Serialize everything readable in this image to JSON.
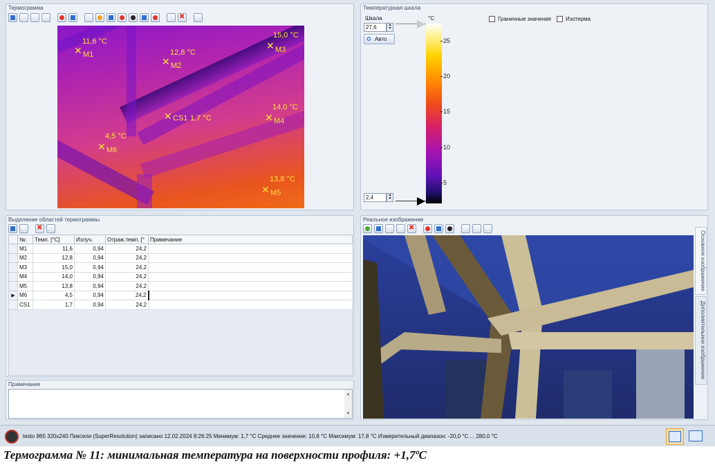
{
  "thermogram_panel": {
    "title": "Термограмма",
    "markers": [
      {
        "id": "M1",
        "temp": "11,6 °C"
      },
      {
        "id": "M2",
        "temp": "12,8 °C"
      },
      {
        "id": "M3",
        "temp": "15,0 °C"
      },
      {
        "id": "M4",
        "temp": "14,0 °C"
      },
      {
        "id": "M5",
        "temp": "13,8 °C"
      },
      {
        "id": "M6",
        "temp": "4,5 °C"
      },
      {
        "id": "CS1",
        "temp": "1,7 °C"
      }
    ]
  },
  "scale_panel": {
    "title": "Температурная шкала",
    "scale_label": "Шкала",
    "max_value": "27,6",
    "min_value": "2,4",
    "auto_label": "Авто",
    "unit": "°C",
    "ticks": [
      "25",
      "20",
      "15",
      "10",
      "5"
    ],
    "limits_label": "Граничные значения",
    "isotherm_label": "Изотерма"
  },
  "regions_panel": {
    "title": "Выделение областей термограммы",
    "columns": [
      "№:",
      "Темп. [°C]",
      "Излуч.",
      "Отраж.темп. [°",
      "Примечание"
    ],
    "rows": [
      {
        "id": "M1",
        "temp": "11,6",
        "emis": "0,94",
        "refl": "24,2",
        "note": ""
      },
      {
        "id": "M2",
        "temp": "12,8",
        "emis": "0,94",
        "refl": "24,2",
        "note": ""
      },
      {
        "id": "M3",
        "temp": "15,0",
        "emis": "0,94",
        "refl": "24,2",
        "note": ""
      },
      {
        "id": "M4",
        "temp": "14,0",
        "emis": "0,94",
        "refl": "24,2",
        "note": ""
      },
      {
        "id": "M5",
        "temp": "13,8",
        "emis": "0,94",
        "refl": "24,2",
        "note": ""
      },
      {
        "id": "M6",
        "temp": "4,5",
        "emis": "0,94",
        "refl": "24,2",
        "note": ""
      },
      {
        "id": "CS1",
        "temp": "1,7",
        "emis": "0,94",
        "refl": "24,2",
        "note": ""
      }
    ],
    "selected_row_marker": "▶"
  },
  "note_panel": {
    "title": "Примечание"
  },
  "photo_panel": {
    "title": "Реальное изображение",
    "tab_main": "Основное изображение",
    "tab_extra": "Дополнительное изображение"
  },
  "status": {
    "text": "testo 865 320x240 Пиксели (SuperResolution) записано 12.02.2024 8:26:25 Минимум: 1,7 °C Среднее значение: 10,8 °C Максимум: 17,8 °C Измерительный диапазон: -20,0 °C ... 280,0 °C"
  },
  "caption": "Термограмма № 11: минимальная температура на поверхности профиля: +1,7ºС"
}
